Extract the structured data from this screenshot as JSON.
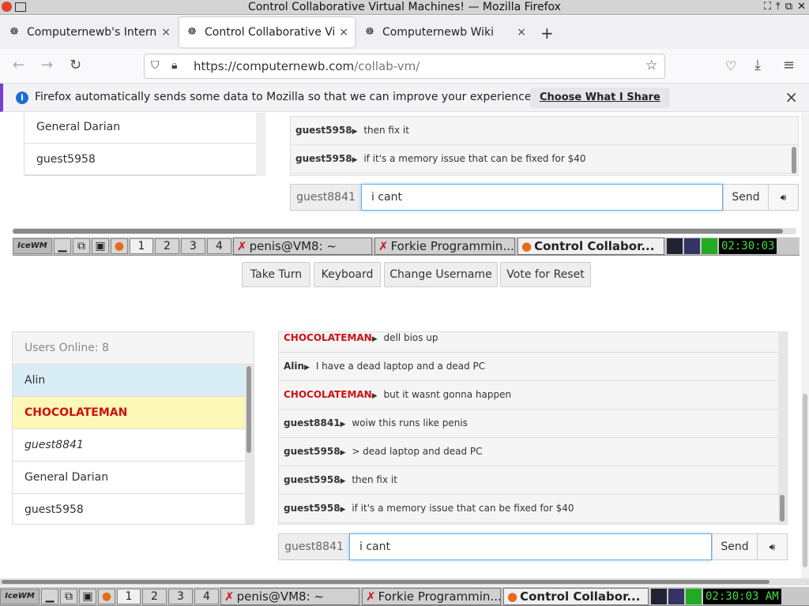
{
  "window": {
    "title": "Control Collaborative Virtual Machines! — Mozilla Firefox"
  },
  "tabs": [
    {
      "label": "Computernewb's Internet",
      "close": "×"
    },
    {
      "label": "Control Collaborative Virtu",
      "close": "×"
    },
    {
      "label": "Computernewb Wiki",
      "close": "×"
    }
  ],
  "newtab": "+",
  "nav": {
    "url_host": "https://computernewb.com",
    "url_path": "/collab-vm/"
  },
  "notification": {
    "message": "Firefox automatically sends some data to Mozilla so that we can improve your experience.",
    "button": "Choose What I Share",
    "close": "×"
  },
  "vm_top": {
    "users": [
      "General Darian",
      "guest5958"
    ],
    "messages": [
      {
        "name": "guest5958",
        "text": "then fix it"
      },
      {
        "name": "guest5958",
        "text": "if it's a memory issue that can be fixed for $40"
      }
    ],
    "input_user": "guest8841",
    "input_value": "i cant",
    "send": "Send"
  },
  "taskbar_top": {
    "workspaces": [
      "1",
      "2",
      "3",
      "4"
    ],
    "tasks": [
      "penis@VM8: ~",
      "Forkie Programmin...",
      "Control Collabor..."
    ],
    "clock": "02:30:03"
  },
  "controls": {
    "take_turn": "Take Turn",
    "keyboard": "Keyboard",
    "change_username": "Change Username",
    "vote_reset": "Vote for Reset"
  },
  "users": {
    "header": "Users Online: 8",
    "list": [
      "Alin",
      "CHOCOLATEMAN",
      "guest8841",
      "General Darian",
      "guest5958"
    ]
  },
  "chat": [
    {
      "name": "CHOCOLATEMAN",
      "text": "dell bios up"
    },
    {
      "name": "Alin",
      "text": "I have a dead laptop and a dead PC"
    },
    {
      "name": "CHOCOLATEMAN",
      "text": "but it wasnt gonna happen"
    },
    {
      "name": "guest8841",
      "text": "woiw this runs like penis"
    },
    {
      "name": "guest5958",
      "text": "> dead laptop and dead PC"
    },
    {
      "name": "guest5958",
      "text": "then fix it"
    },
    {
      "name": "guest5958",
      "text": "if it's a memory issue that can be fixed for $40"
    }
  ],
  "chat_input": {
    "user": "guest8841",
    "value": "i cant",
    "send": "Send"
  },
  "taskbar_bottom": {
    "workspaces": [
      "1",
      "2",
      "3",
      "4"
    ],
    "tasks": [
      "penis@VM8: ~",
      "Forkie Programmin...",
      "Control Collabor..."
    ],
    "clock": "02:30:03 AM"
  },
  "colors": {
    "mod_red": "#d01010",
    "highlight_blue": "#d9edf7",
    "highlight_yellow": "#fcf8b5",
    "clock_green": "#3ee03e"
  }
}
